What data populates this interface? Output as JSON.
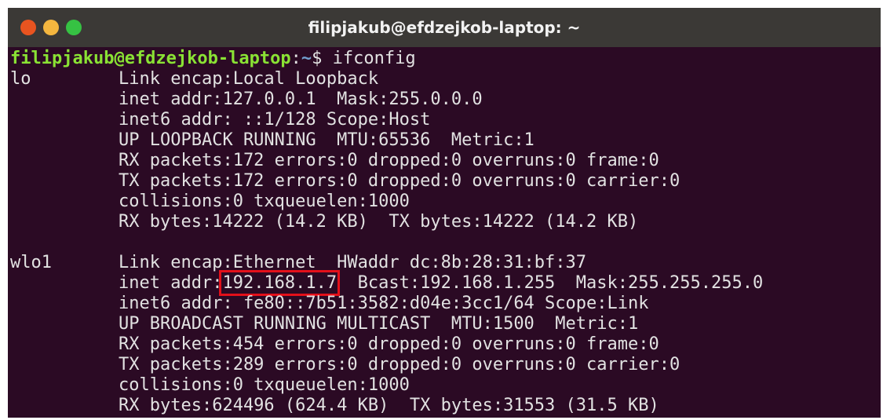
{
  "window": {
    "title": "filipjakub@efdzejkob-laptop: ~"
  },
  "prompt": {
    "user_host": "filipjakub@efdzejkob-laptop",
    "colon": ":",
    "path": "~",
    "symbol": "$ ",
    "command": "ifconfig"
  },
  "interfaces": {
    "lo": {
      "name": "lo",
      "lines": [
        "Link encap:Local Loopback",
        "inet addr:127.0.0.1  Mask:255.0.0.0",
        "inet6 addr: ::1/128 Scope:Host",
        "UP LOOPBACK RUNNING  MTU:65536  Metric:1",
        "RX packets:172 errors:0 dropped:0 overruns:0 frame:0",
        "TX packets:172 errors:0 dropped:0 overruns:0 carrier:0",
        "collisions:0 txqueuelen:1000",
        "RX bytes:14222 (14.2 KB)  TX bytes:14222 (14.2 KB)"
      ]
    },
    "wlo1": {
      "name": "wlo1",
      "link": "Link encap:Ethernet  HWaddr dc:8b:28:31:bf:37",
      "inet_prefix": "inet addr:",
      "inet_addr": "192.168.1.7",
      "inet_suffix": "  Bcast:192.168.1.255  Mask:255.255.255.0",
      "lines": [
        "inet6 addr: fe80::7b51:3582:d04e:3cc1/64 Scope:Link",
        "UP BROADCAST RUNNING MULTICAST  MTU:1500  Metric:1",
        "RX packets:454 errors:0 dropped:0 overruns:0 frame:0",
        "TX packets:289 errors:0 dropped:0 overruns:0 carrier:0",
        "collisions:0 txqueuelen:1000",
        "RX bytes:624496 (624.4 KB)  TX bytes:31553 (31.5 KB)"
      ]
    }
  },
  "colors": {
    "terminal_bg": "#2b0a24",
    "titlebar_bg": "#3b3936",
    "prompt_user": "#8ae234",
    "prompt_path": "#729fcf",
    "highlight": "#e3101a"
  }
}
